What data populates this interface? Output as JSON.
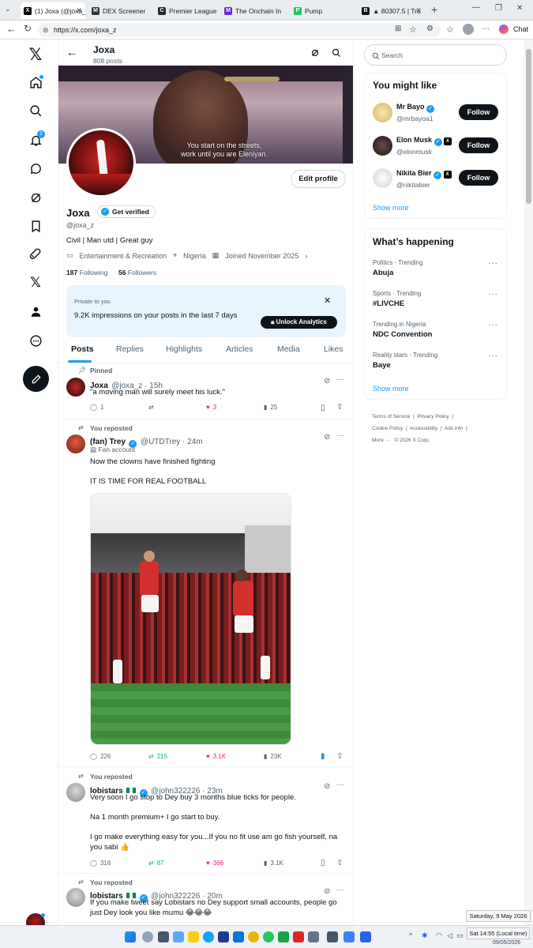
{
  "browser": {
    "tabs": [
      {
        "label": "(1) Joxa (@joxa_z",
        "favicon": "X",
        "color": "#000000"
      },
      {
        "label": "DEX Screener",
        "favicon": "M",
        "color": "#333333"
      },
      {
        "label": "Premier League",
        "favicon": "C",
        "color": "#1f2937"
      },
      {
        "label": "The Onchain In",
        "favicon": "M",
        "color": "#6d28d9"
      },
      {
        "label": "Pump",
        "favicon": "P",
        "color": "#22c55e"
      },
      {
        "label": "▲ 80307.5 | Tra",
        "favicon": "B",
        "color": "#111111"
      }
    ],
    "url": "https://x.com/joxa_z",
    "chat_label": "Chat"
  },
  "profile": {
    "header_name": "Joxa",
    "post_count": "808 posts",
    "banner_caption_line1": "You start on the streets,",
    "banner_caption_line2": "work until you are Eleniyan.",
    "edit_profile": "Edit profile",
    "name": "Joxa",
    "get_verified": "Get verified",
    "handle": "@joxa_z",
    "bio": "Civil | Man utd | Great guy",
    "category": "Entertainment & Recreation",
    "location": "Nigeria",
    "joined": "Joined November 2025",
    "following_count": "187",
    "following_label": "Following",
    "followers_count": "56",
    "followers_label": "Followers"
  },
  "private_box": {
    "label": "Private to you",
    "text": "9.2K impressions on your posts in the last 7 days",
    "button": "Unlock Analytics"
  },
  "profile_tabs": [
    "Posts",
    "Replies",
    "Highlights",
    "Articles",
    "Media",
    "Likes"
  ],
  "posts": [
    {
      "context": "Pinned",
      "name": "Joxa",
      "handle": "@joxa_z · 15h",
      "text": "\"a moving man will surely meet his luck.\"",
      "replies": "1",
      "reposts": "",
      "likes": "3",
      "views": "25"
    },
    {
      "context": "You reposted",
      "name": "(fan) Trey",
      "handle": "@UTDTrey · 24m",
      "badge": "Fan account",
      "text1": "Now the clowns have finished fighting",
      "text2": "IT IS TIME FOR REAL FOOTBALL",
      "replies": "226",
      "reposts": "215",
      "likes": "3.1K",
      "views": "23K"
    },
    {
      "context": "You reposted",
      "name": "lobistars",
      "handle": "@john322226 · 23m",
      "text1": "Very soon I go stop to Dey buy 3 months blue ticks for people.",
      "text2": "Na 1 month premium+ I go start to buy.",
      "text3": "I go make everything easy for you...If you no fit use am go fish yourself, na you sabi 👍",
      "replies": "316",
      "reposts": "87",
      "likes": "366",
      "views": "3.1K"
    },
    {
      "context": "You reposted",
      "name": "lobistars",
      "handle": "@john322226 · 20m",
      "text1": "If you make tweet say Lobistars no Dey support small accounts, people go just Dey look you like mumu 😂😂😂"
    }
  ],
  "search": {
    "placeholder": "Search"
  },
  "might_like": {
    "title": "You might like",
    "users": [
      {
        "name": "Mr Bayo",
        "handle": "@mrbayoa1",
        "button": "Follow"
      },
      {
        "name": "Elon Musk",
        "handle": "@elonmusk",
        "button": "Follow"
      },
      {
        "name": "Nikita Bier",
        "handle": "@nikitabier",
        "button": "Follow"
      }
    ],
    "show_more": "Show more"
  },
  "happening": {
    "title": "What’s happening",
    "trends": [
      {
        "category": "Politics · Trending",
        "name": "Abuja"
      },
      {
        "category": "Sports · Trending",
        "name": "#LIVCHE"
      },
      {
        "category": "Trending in Nigeria",
        "name": "NDC Convention"
      },
      {
        "category": "Reality stars · Trending",
        "name": "Baye"
      }
    ],
    "show_more": "Show more"
  },
  "footer": {
    "links": [
      "Terms of Service",
      "Privacy Policy",
      "Cookie Policy",
      "Accessibility",
      "Ads info",
      "More ···"
    ],
    "copyright": "© 2026 X Corp."
  },
  "taskbar": {
    "date_tooltip": "Saturday, 9 May 2026",
    "time_tooltip": "Sat 14:55 (Local time)",
    "date_small": "09/05/2026"
  },
  "colors": {
    "accent": "#1d9bf0",
    "like": "#f91880",
    "repost": "#00ba7c",
    "dark": "#0f1419"
  }
}
